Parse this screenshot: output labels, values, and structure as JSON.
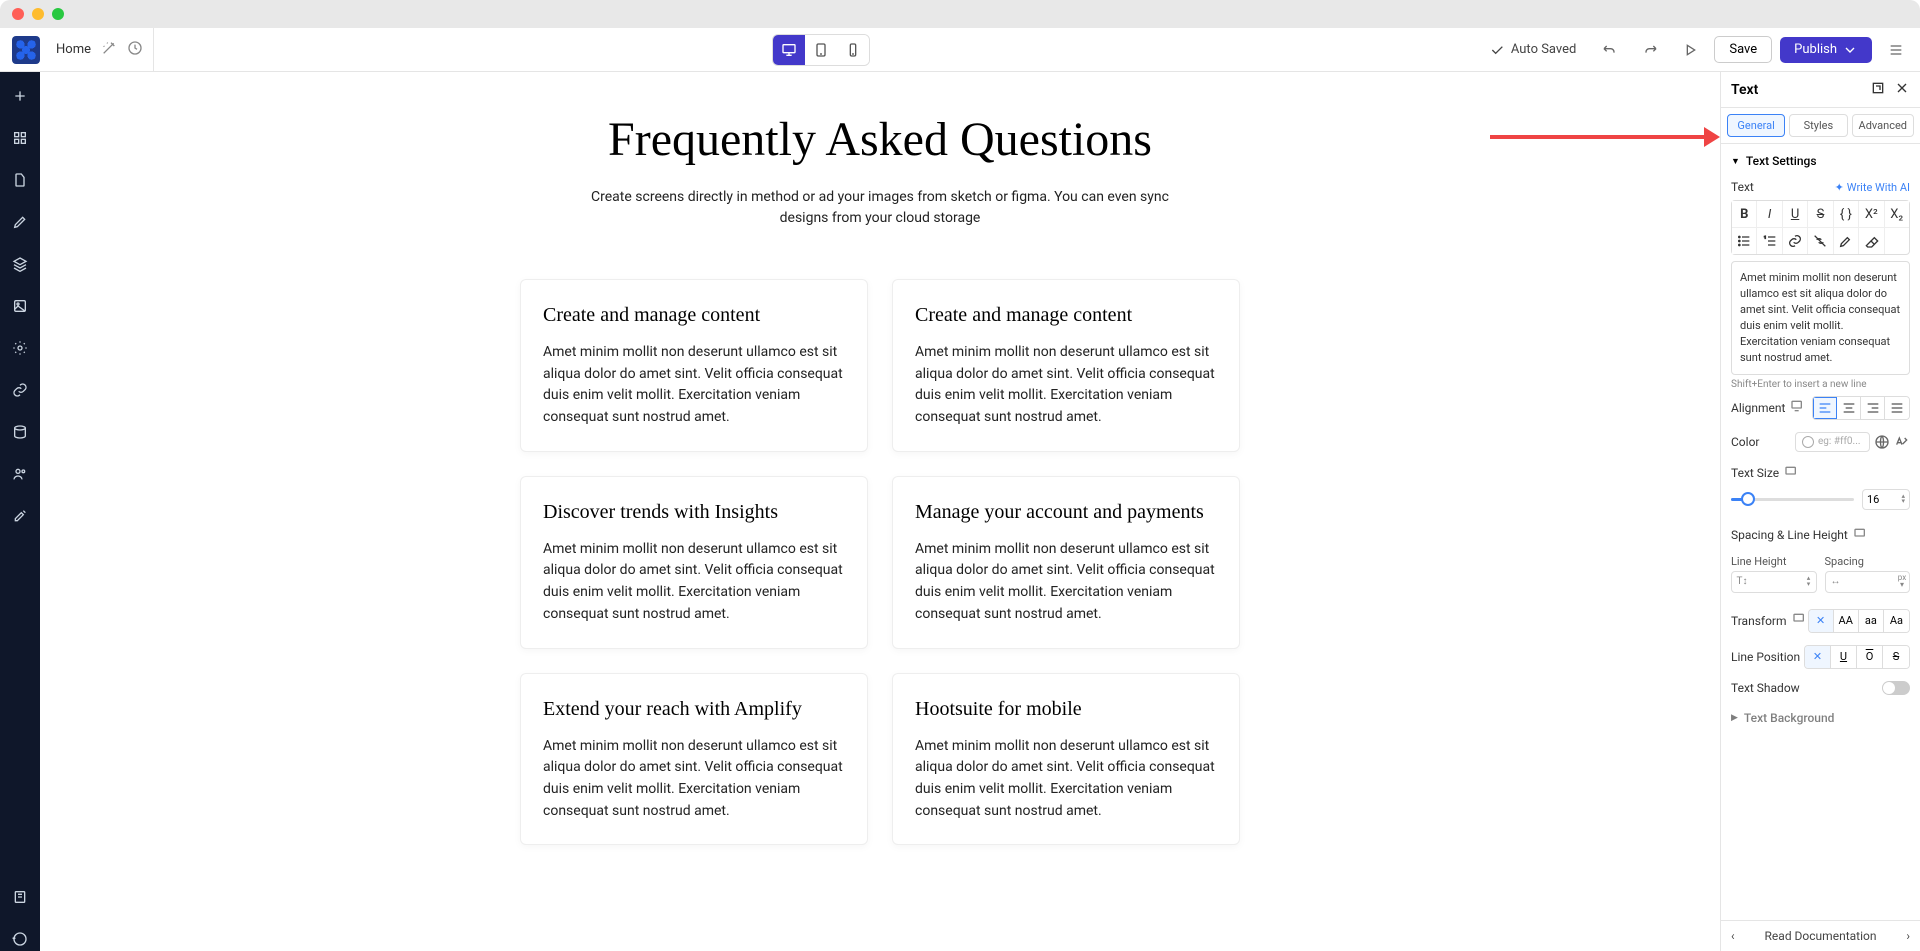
{
  "topbar": {
    "breadcrumb": "Home",
    "autosaved": "Auto Saved",
    "save": "Save",
    "publish": "Publish"
  },
  "canvas": {
    "title": "Frequently Asked Questions",
    "subtitle": "Create screens directly in method or ad your images from sketch or figma. You can even sync designs from your cloud storage",
    "cards": [
      {
        "title": "Create and manage content",
        "body": "Amet minim mollit non deserunt ullamco est sit aliqua dolor do amet sint. Velit officia consequat duis enim velit mollit. Exercitation veniam consequat sunt nostrud amet."
      },
      {
        "title": "Create and manage content",
        "body": "Amet minim mollit non deserunt ullamco est sit aliqua dolor do amet sint. Velit officia consequat duis enim velit mollit. Exercitation veniam consequat sunt nostrud amet."
      },
      {
        "title": "Discover trends with Insights",
        "body": "Amet minim mollit non deserunt ullamco est sit aliqua dolor do amet sint. Velit officia consequat duis enim velit mollit. Exercitation veniam consequat sunt nostrud amet."
      },
      {
        "title": "Manage your account and payments",
        "body": "Amet minim mollit non deserunt ullamco est sit aliqua dolor do amet sint. Velit officia consequat duis enim velit mollit. Exercitation veniam consequat sunt nostrud amet."
      },
      {
        "title": "Extend your reach with Amplify",
        "body": "Amet minim mollit non deserunt ullamco est sit aliqua dolor do amet sint. Velit officia consequat duis enim velit mollit. Exercitation veniam consequat sunt nostrud amet."
      },
      {
        "title": "Hootsuite for mobile",
        "body": "Amet minim mollit non deserunt ullamco est sit aliqua dolor do amet sint. Velit officia consequat duis enim velit mollit. Exercitation veniam consequat sunt nostrud amet."
      }
    ]
  },
  "panel": {
    "header_title": "Text",
    "tabs": {
      "general": "General",
      "styles": "Styles",
      "advanced": "Advanced"
    },
    "text_settings": "Text Settings",
    "text_label": "Text",
    "write_ai": "Write With AI",
    "editor_content": "Amet minim mollit non deserunt ullamco est sit aliqua dolor do amet sint. Velit officia consequat duis enim velit mollit. Exercitation veniam consequat sunt nostrud amet.",
    "editor_hint": "Shift+Enter to insert a new line",
    "alignment": "Alignment",
    "color": "Color",
    "color_placeholder": "eg: #ff0...",
    "text_size": "Text Size",
    "text_size_value": "16",
    "spacing_lh": "Spacing & Line Height",
    "line_height": "Line Height",
    "spacing": "Spacing",
    "transform": "Transform",
    "transform_options": {
      "none": "✕",
      "upper": "AA",
      "lower": "aa",
      "cap": "Aa"
    },
    "line_position": "Line Position",
    "text_shadow": "Text Shadow",
    "text_background": "Text Background",
    "footer": "Read Documentation"
  }
}
